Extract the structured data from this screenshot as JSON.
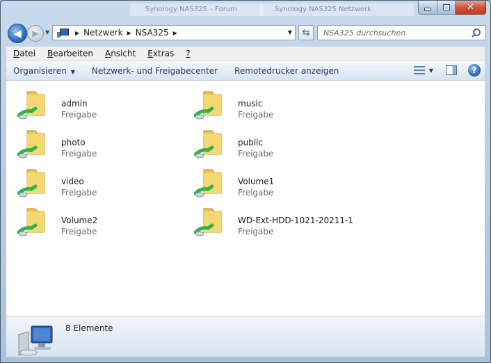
{
  "window": {
    "background_tabs": [
      "Synology NAS325 – Forum",
      "Synology NAS325 Netzwerk"
    ],
    "caption_minimize": "–",
    "caption_close": "✕"
  },
  "nav": {
    "breadcrumb": [
      "Netzwerk",
      "NSA325"
    ],
    "search_placeholder": "NSA325 durchsuchen"
  },
  "menu": [
    "Datei",
    "Bearbeiten",
    "Ansicht",
    "Extras",
    "?"
  ],
  "menu_access_keys": [
    "D",
    "B",
    "A",
    "E",
    "?"
  ],
  "commands": {
    "organize": "Organisieren",
    "network_center": "Netzwerk- und Freigabecenter",
    "remote_printers": "Remotedrucker anzeigen"
  },
  "shares": [
    {
      "name": "admin",
      "type": "Freigabe"
    },
    {
      "name": "music",
      "type": "Freigabe"
    },
    {
      "name": "photo",
      "type": "Freigabe"
    },
    {
      "name": "public",
      "type": "Freigabe"
    },
    {
      "name": "video",
      "type": "Freigabe"
    },
    {
      "name": "Volume1",
      "type": "Freigabe"
    },
    {
      "name": "Volume2",
      "type": "Freigabe"
    },
    {
      "name": "WD-Ext-HDD-1021-20211-1",
      "type": "Freigabe"
    }
  ],
  "details": {
    "item_count": "8 Elemente"
  },
  "colors": {
    "folder": "#f3cf62",
    "network_pipe": "#2fb34a",
    "accent": "#1e395b"
  }
}
